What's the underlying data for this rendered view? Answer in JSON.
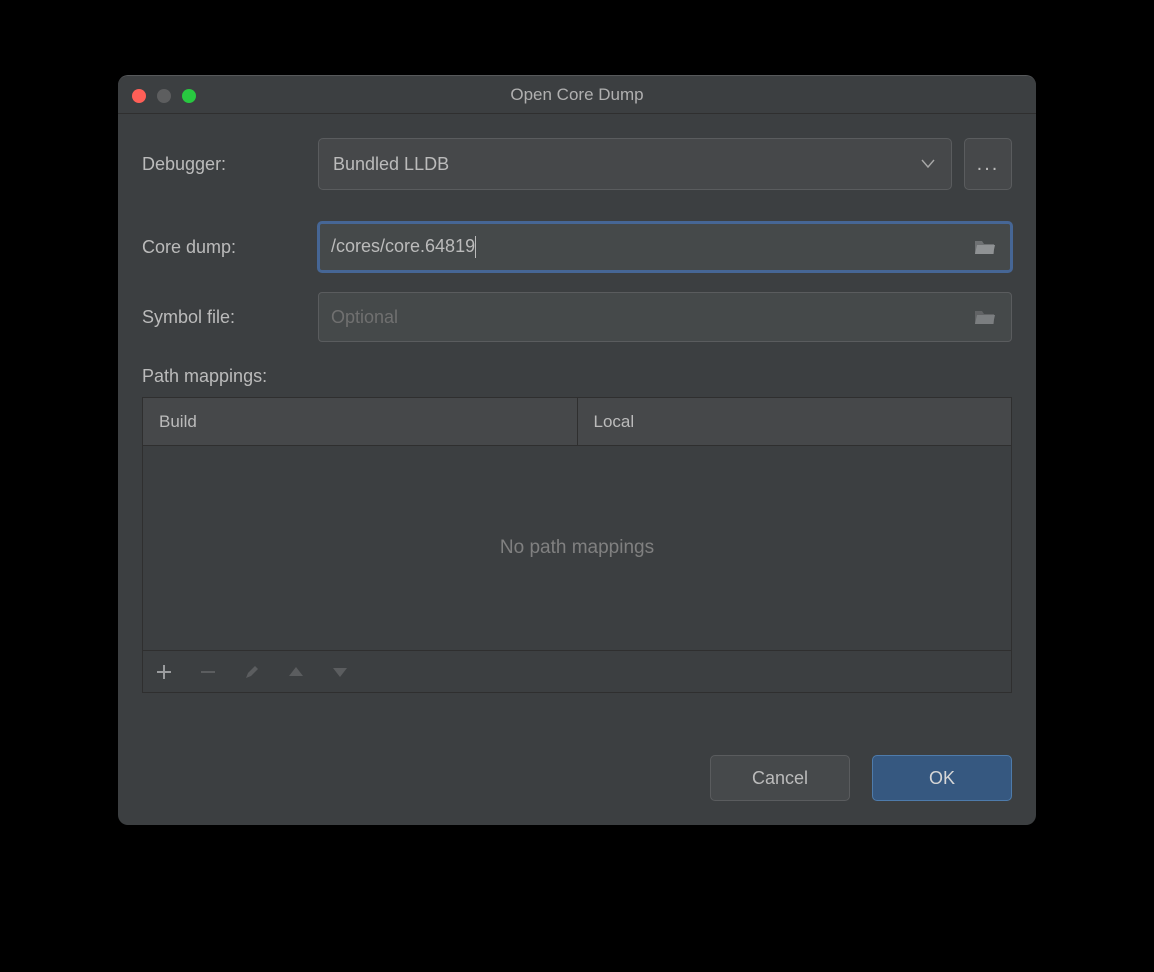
{
  "dialog": {
    "title": "Open Core Dump",
    "labels": {
      "debugger": "Debugger:",
      "core_dump": "Core dump:",
      "symbol_file": "Symbol file:",
      "path_mappings": "Path mappings:"
    },
    "debugger_dropdown": {
      "selected": "Bundled LLDB"
    },
    "core_dump_input": {
      "value": "/cores/core.64819"
    },
    "symbol_file_input": {
      "placeholder": "Optional",
      "value": ""
    },
    "table": {
      "columns": {
        "build": "Build",
        "local": "Local"
      },
      "empty_text": "No path mappings",
      "rows": []
    },
    "buttons": {
      "ellipsis": "...",
      "cancel": "Cancel",
      "ok": "OK"
    }
  }
}
